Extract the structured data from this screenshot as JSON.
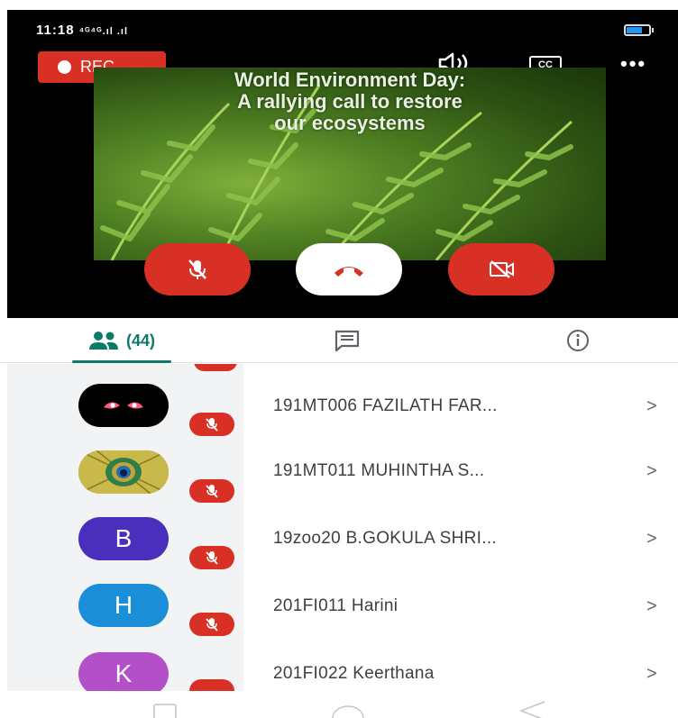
{
  "status_bar": {
    "time": "11:18",
    "signal_text": "⁴ᴳ⁴ᴳ.ıl .ıl"
  },
  "call": {
    "rec_label": "REC",
    "cc_label": "CC",
    "more_label": "•••",
    "slide_title_lines": [
      "World Environment Day:",
      "A rallying call to restore",
      "our ecosystems"
    ]
  },
  "tabs": {
    "people_count": "(44)"
  },
  "participants": [
    {
      "name": "191MT006 FAZILATH FAR...",
      "avatar_letter": "",
      "avatar_type": "eyes",
      "chevron": ">"
    },
    {
      "name": "191MT011 MUHINTHA S...",
      "avatar_letter": "",
      "avatar_type": "peacock",
      "chevron": ">"
    },
    {
      "name": "19zoo20 B.GOKULA SHRI...",
      "avatar_letter": "B",
      "avatar_color": "#4a2fbd",
      "chevron": ">"
    },
    {
      "name": "201FI011 Harini",
      "avatar_letter": "H",
      "avatar_color": "#1a8fd8",
      "chevron": ">"
    },
    {
      "name": "201FI022 Keerthana",
      "avatar_letter": "K",
      "avatar_color": "#b24fc9",
      "chevron": ">"
    }
  ],
  "colors": {
    "accent": "#0b7a68",
    "danger": "#d93025"
  }
}
